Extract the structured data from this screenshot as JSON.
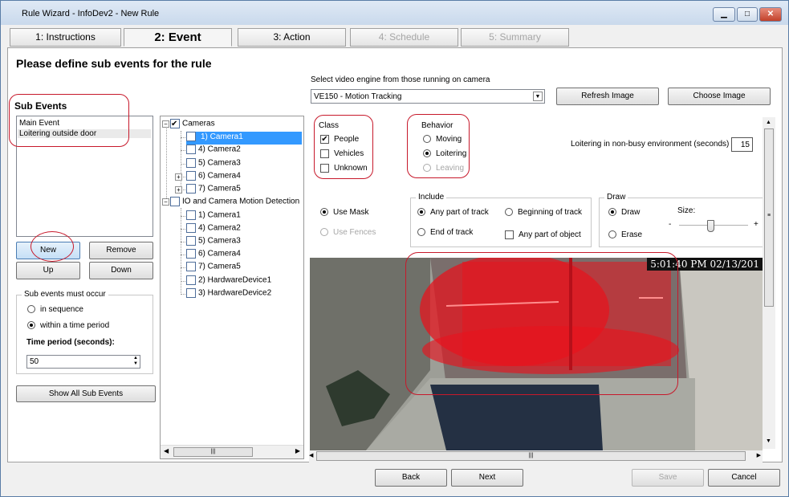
{
  "window": {
    "title": "Rule Wizard - InfoDev2 - New Rule",
    "minimize": "▁",
    "maximize": "□",
    "close": "✕"
  },
  "tabs": [
    {
      "label": "1: Instructions"
    },
    {
      "label": "2: Event"
    },
    {
      "label": "3: Action"
    },
    {
      "label": "4: Schedule"
    },
    {
      "label": "5: Summary"
    }
  ],
  "heading": "Please define sub events for the rule",
  "sub_events": {
    "label": "Sub Events",
    "items": [
      "Main Event",
      "Loitering outside door"
    ]
  },
  "buttons": {
    "new": "New",
    "remove": "Remove",
    "up": "Up",
    "down": "Down",
    "show_all": "Show All Sub Events",
    "refresh": "Refresh Image",
    "choose": "Choose Image",
    "back": "Back",
    "next": "Next",
    "save": "Save",
    "cancel": "Cancel"
  },
  "order": {
    "label": "Sub events must occur",
    "opt1": "in sequence",
    "opt2": "within a time period",
    "time_label": "Time period (seconds):",
    "time_value": "50"
  },
  "tree": {
    "cameras": "Cameras",
    "camera_items": [
      "1) Camera1",
      "4) Camera2",
      "5) Camera3",
      "6) Camera4",
      "7) Camera5"
    ],
    "io": "IO and Camera Motion Detection",
    "io_items": [
      "1) Camera1",
      "4) Camera2",
      "5) Camera3",
      "6) Camera4",
      "7) Camera5",
      "2) HardwareDevice1",
      "3) HardwareDevice2"
    ]
  },
  "engine": {
    "label": "Select video engine from those running on camera",
    "value": "VE150 - Motion Tracking"
  },
  "class": {
    "label": "Class",
    "items": [
      "People",
      "Vehicles",
      "Unknown"
    ]
  },
  "behavior": {
    "label": "Behavior",
    "items": [
      "Moving",
      "Loitering",
      "Leaving"
    ]
  },
  "loiter": {
    "label": "Loitering in non-busy environment (seconds)",
    "value": "15"
  },
  "mask": {
    "use_mask": "Use Mask",
    "use_fences": "Use Fences"
  },
  "include": {
    "label": "Include",
    "any_part": "Any part of track",
    "beginning": "Beginning of track",
    "end": "End of track",
    "any_object": "Any part of object"
  },
  "draw": {
    "label": "Draw",
    "draw": "Draw",
    "erase": "Erase",
    "size": "Size:",
    "minus": "-",
    "plus": "+"
  },
  "video": {
    "timestamp": "5:01:40 PM 02/13/201"
  },
  "colors": {
    "mask": "#e6141e",
    "annotation": "#c7192b",
    "selection": "#3399ff"
  }
}
